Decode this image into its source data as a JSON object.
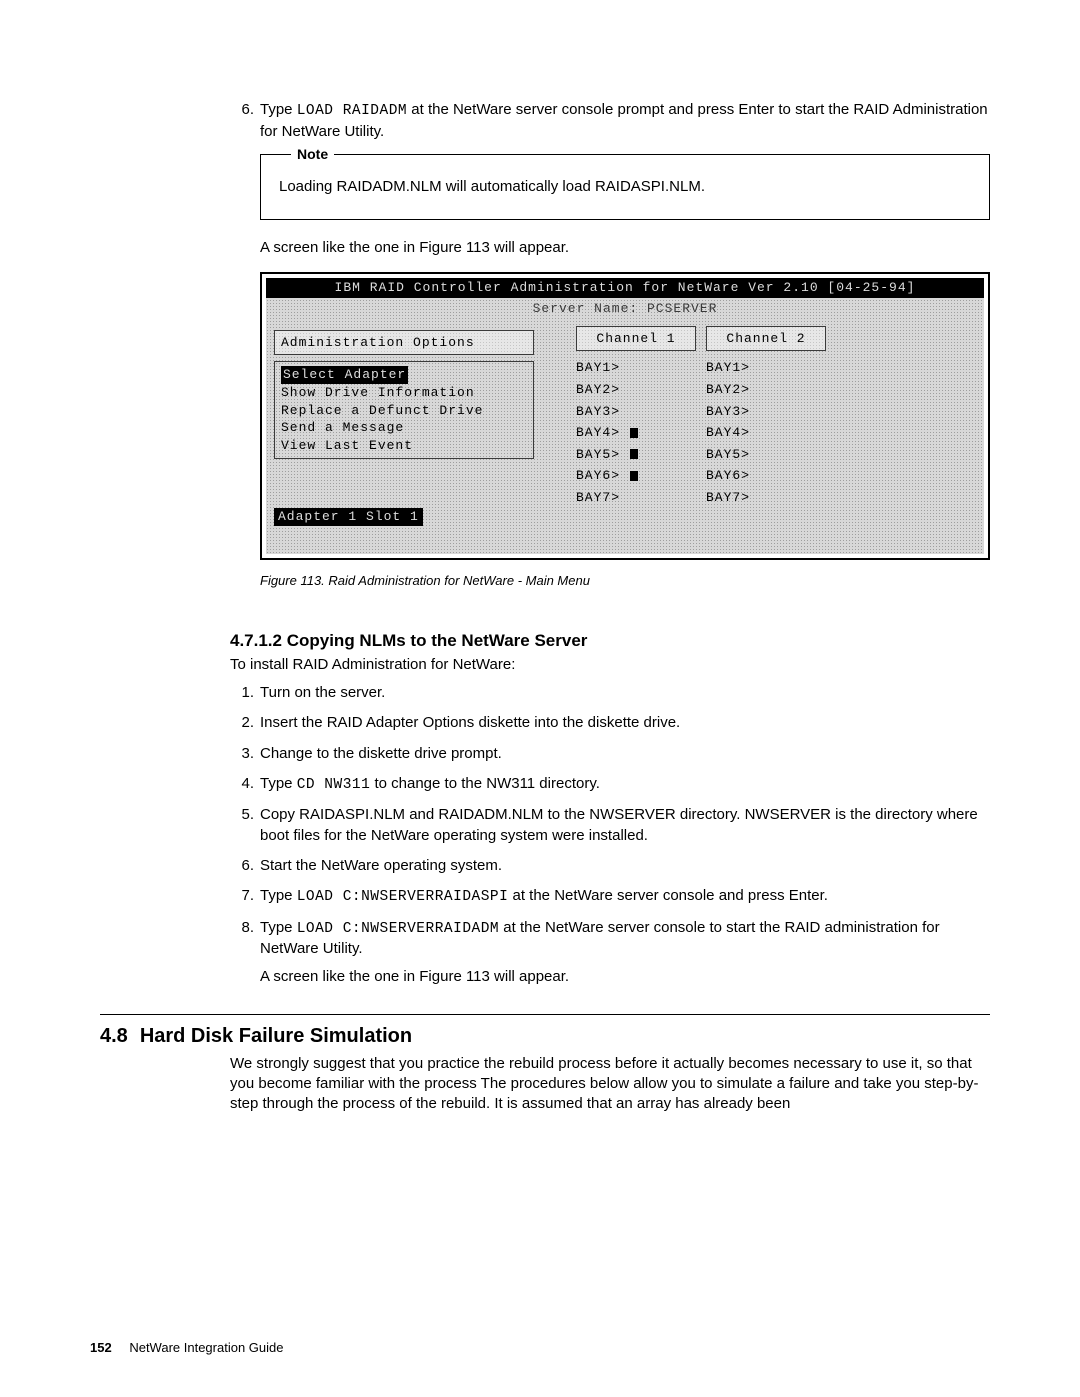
{
  "step6": {
    "num": "6.",
    "pre": "Type ",
    "cmd": "LOAD RAIDADM",
    "post": " at the NetWare server console prompt and press Enter to start the RAID Administration for NetWare Utility."
  },
  "note": {
    "label": "Note",
    "body": "Loading RAIDADM.NLM will automatically load RAIDASPI.NLM."
  },
  "after_note": "A screen like the one in Figure 113 will appear.",
  "figure": {
    "title": "IBM RAID Controller Administration for NetWare  Ver 2.10 [04-25-94]",
    "subtitle": "Server Name: PCSERVER",
    "admin_title": "Administration Options",
    "menu": {
      "i0": "Select Adapter",
      "i1": "Show Drive Information",
      "i2": "Replace a Defunct Drive",
      "i3": "Send a Message",
      "i4": "View Last Event"
    },
    "ch1_title": "Channel 1",
    "ch2_title": "Channel 2",
    "bays": {
      "b1": "BAY1>",
      "b2": "BAY2>",
      "b3": "BAY3>",
      "b4": "BAY4>",
      "b5": "BAY5>",
      "b6": "BAY6>",
      "b7": "BAY7>"
    },
    "adapter_status": "Adapter 1 Slot 1",
    "caption": "Figure 113. Raid Administration for NetWare - Main Menu"
  },
  "sec_47": {
    "heading": "4.7.1.2  Copying NLMs to the NetWare Server",
    "intro": "To install RAID Administration for NetWare:",
    "items": {
      "n1": "1.",
      "t1": "Turn on the server.",
      "n2": "2.",
      "t2": "Insert the RAID Adapter Options diskette into the diskette drive.",
      "n3": "3.",
      "t3": "Change to the diskette drive prompt.",
      "n4": "4.",
      "t4a": "Type ",
      "t4cmd": "CD NW311",
      "t4b": " to change to the NW311 directory.",
      "n5": "5.",
      "t5": "Copy RAIDASPI.NLM and RAIDADM.NLM to the NWSERVER directory. NWSERVER is the directory where boot files for the NetWare operating system were installed.",
      "n6": "6.",
      "t6": "Start the NetWare operating system.",
      "n7": "7.",
      "t7a": "Type ",
      "t7cmd": "LOAD C:NWSERVERRAIDASPI",
      "t7b": " at the NetWare server console and press Enter.",
      "n8": "8.",
      "t8a": "Type ",
      "t8cmd": "LOAD C:NWSERVERRAIDADM",
      "t8b": " at the NetWare server console to start the RAID administration for NetWare Utility.",
      "t8c": "A screen like the one in Figure 113 will appear."
    }
  },
  "sec_48": {
    "num": "4.8",
    "title": "Hard Disk Failure Simulation",
    "body": "We strongly suggest that you practice the rebuild process before it actually becomes necessary to use it, so that you become familiar with the process The procedures below allow you to simulate a failure and take you step-by-step through the process of the rebuild.  It is assumed that an array has already been"
  },
  "footer": {
    "page": "152",
    "book": "NetWare Integration Guide"
  }
}
